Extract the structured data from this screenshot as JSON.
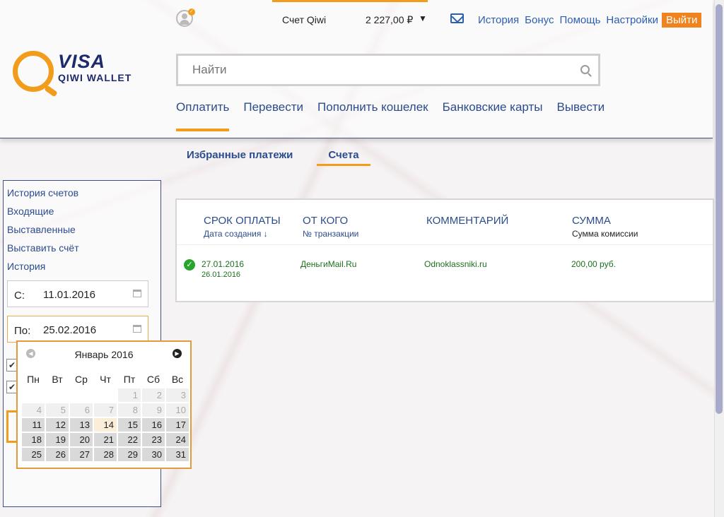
{
  "header": {
    "account_label": "Счет Qiwi",
    "balance": "2 227,00 ₽",
    "links": [
      "История",
      "Бонус",
      "Помощь",
      "Настройки"
    ],
    "logout": "Выйти",
    "logo_visa": "VISA",
    "logo_wallet": "QIWI WALLET"
  },
  "search": {
    "placeholder": "Найти"
  },
  "main_nav": [
    "Оплатить",
    "Перевести",
    "Пополнить кошелек",
    "Банковские карты",
    "Вывести"
  ],
  "main_nav_active": "Оплатить",
  "sub_tabs": [
    "Избранные платежи",
    "Счета"
  ],
  "sub_tab_active": "Счета",
  "sidebar": {
    "menu": [
      "История счетов",
      "Входящие",
      "Выставленные",
      "Выставить счёт",
      "История"
    ],
    "date_from_label": "С:",
    "date_from": "11.01.2016",
    "date_to_label": "По:",
    "date_to": "25.02.2016"
  },
  "datepicker": {
    "month_title": "Январь 2016",
    "weekdays": [
      "Пн",
      "Вт",
      "Ср",
      "Чт",
      "Пт",
      "Сб",
      "Вс"
    ],
    "weeks": [
      [
        "",
        "",
        "",
        "",
        "1",
        "2",
        "3"
      ],
      [
        "4",
        "5",
        "6",
        "7",
        "8",
        "9",
        "10"
      ],
      [
        "11",
        "12",
        "13",
        "14",
        "15",
        "16",
        "17"
      ],
      [
        "18",
        "19",
        "20",
        "21",
        "22",
        "23",
        "24"
      ],
      [
        "25",
        "26",
        "27",
        "28",
        "29",
        "30",
        "31"
      ]
    ],
    "disabled_through_day": 10,
    "highlighted_day": "14"
  },
  "invoices": {
    "columns": [
      {
        "title": "СРОК ОПЛАТЫ",
        "subtitle": "Дата создания ↓"
      },
      {
        "title": "ОТ КОГО",
        "subtitle": "№ транзакции"
      },
      {
        "title": "КОММЕНТАРИЙ",
        "subtitle": ""
      },
      {
        "title": "СУММА",
        "subtitle": "Сумма комиссии"
      }
    ],
    "rows": [
      {
        "status": "paid",
        "due_date": "27.01.2016",
        "created_date": "26.01.2016",
        "from": "ДеньгиMail.Ru",
        "comment": "Odnoklassniki.ru",
        "amount": "200,00 руб."
      }
    ]
  },
  "colors": {
    "accent": "#f29c1c",
    "link": "#2b4c8c",
    "success": "#27a52f",
    "logout": "#f0831e"
  }
}
